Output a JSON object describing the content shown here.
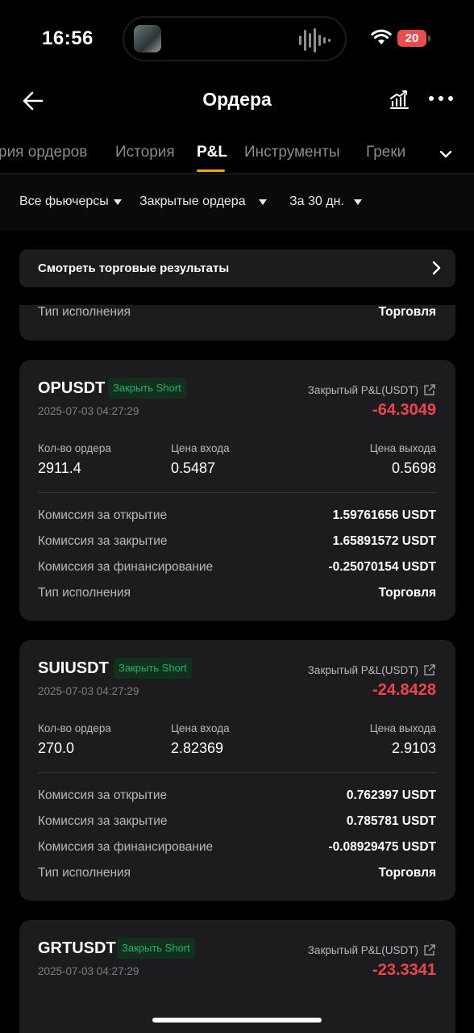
{
  "status_bar": {
    "time": "16:56",
    "battery": "20"
  },
  "header": {
    "title": "Ордера"
  },
  "tabs": [
    {
      "label": "рия ордеров"
    },
    {
      "label": "История"
    },
    {
      "label": "P&L"
    },
    {
      "label": "Инструменты"
    },
    {
      "label": "Греки"
    }
  ],
  "active_tab": "P&L",
  "filters": [
    {
      "label": "Все фьючерсы"
    },
    {
      "label": "Закрытые ордера"
    },
    {
      "label": "За 30 дн."
    }
  ],
  "results_link": "Смотреть торговые результаты",
  "partial_card": {
    "key": "Тип исполнения",
    "value": "Торговля"
  },
  "labels": {
    "closed_pnl": "Закрытый P&L(USDT)",
    "qty": "Кол-во ордера",
    "entry": "Цена входа",
    "exit": "Цена выхода",
    "fee_open": "Комиссия за открытие",
    "fee_close": "Комиссия за закрытие",
    "fee_funding": "Комиссия за финансирование",
    "exec_type": "Тип исполнения"
  },
  "colors": {
    "accent": "#f7a600",
    "loss": "#ef454a",
    "badge_green": "#20b26c"
  },
  "cards": [
    {
      "symbol": "OPUSDT",
      "badge": "Закрыть Short",
      "date": "2025-07-03 04:27:29",
      "pnl": "-64.3049",
      "qty": "2911.4",
      "entry": "0.5487",
      "exit": "0.5698",
      "fee_open": "1.59761656 USDT",
      "fee_close": "1.65891572 USDT",
      "fee_funding": "-0.25070154 USDT",
      "exec_type": "Торговля"
    },
    {
      "symbol": "SUIUSDT",
      "badge": "Закрыть Short",
      "date": "2025-07-03 04:27:29",
      "pnl": "-24.8428",
      "qty": "270.0",
      "entry": "2.82369",
      "exit": "2.9103",
      "fee_open": "0.762397 USDT",
      "fee_close": "0.785781 USDT",
      "fee_funding": "-0.08929475 USDT",
      "exec_type": "Торговля"
    },
    {
      "symbol": "GRTUSDT",
      "badge": "Закрыть Short",
      "date": "2025-07-03 04:27:29",
      "pnl": "-23.3341"
    }
  ]
}
